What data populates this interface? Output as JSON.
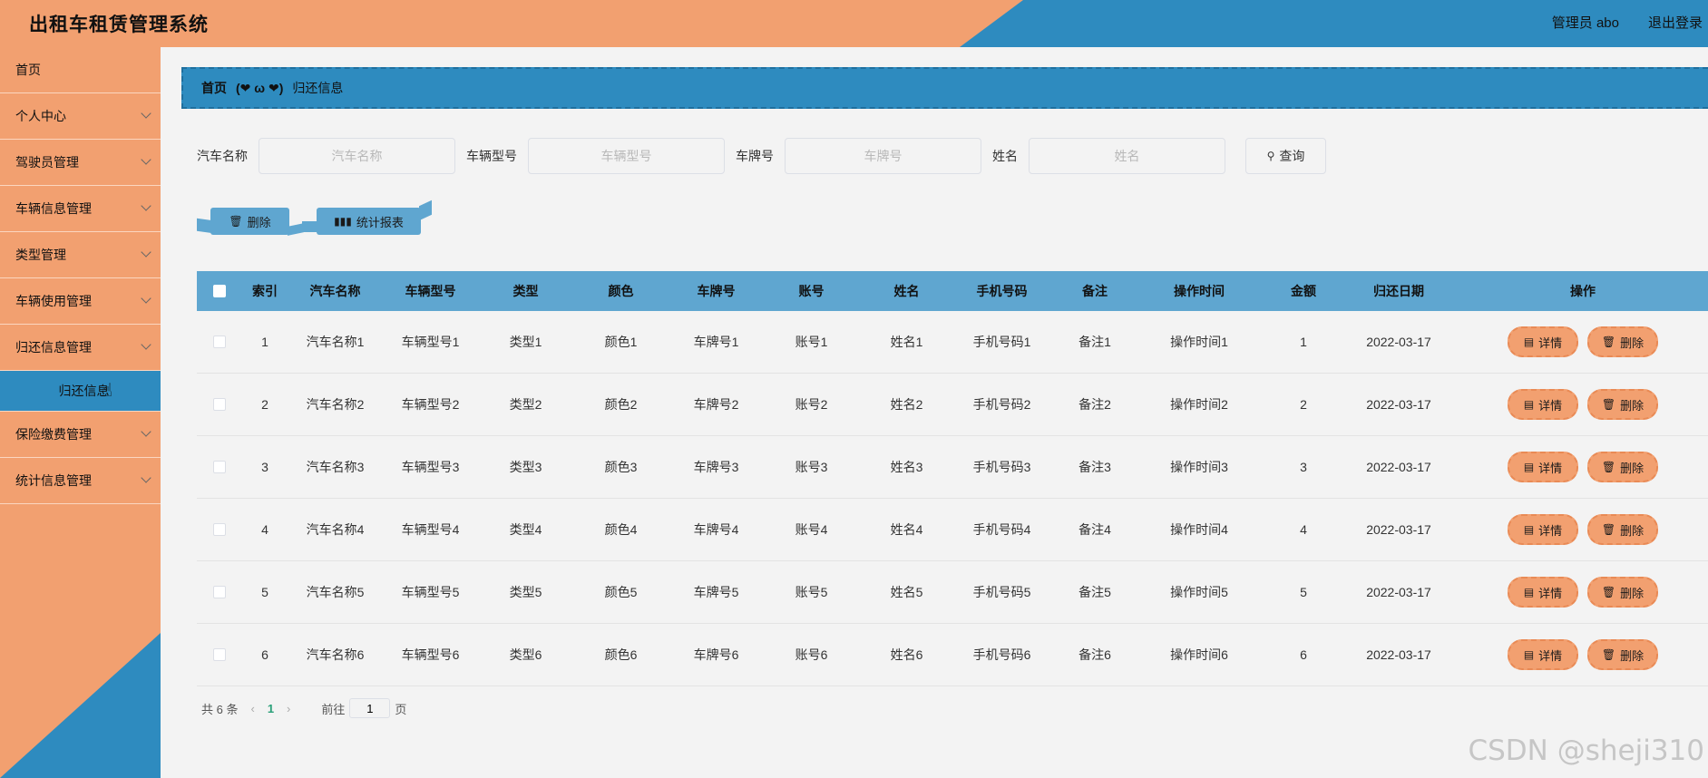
{
  "header": {
    "title": "出租车租赁管理系统",
    "user": "管理员 abo",
    "logout": "退出登录"
  },
  "sidebar": {
    "items": [
      {
        "label": "首页",
        "has_chevron": false
      },
      {
        "label": "个人中心",
        "has_chevron": true
      },
      {
        "label": "驾驶员管理",
        "has_chevron": true
      },
      {
        "label": "车辆信息管理",
        "has_chevron": true
      },
      {
        "label": "类型管理",
        "has_chevron": true
      },
      {
        "label": "车辆使用管理",
        "has_chevron": true
      },
      {
        "label": "归还信息管理",
        "has_chevron": true
      },
      {
        "label": "保险缴费管理",
        "has_chevron": true
      },
      {
        "label": "统计信息管理",
        "has_chevron": true
      }
    ],
    "active_sub": "归还信息"
  },
  "breadcrumb": {
    "home": "首页",
    "separator": "(❤ ω ❤)",
    "current": "归还信息"
  },
  "search": {
    "fields": [
      {
        "label": "汽车名称",
        "placeholder": "汽车名称"
      },
      {
        "label": "车辆型号",
        "placeholder": "车辆型号"
      },
      {
        "label": "车牌号",
        "placeholder": "车牌号"
      },
      {
        "label": "姓名",
        "placeholder": "姓名"
      }
    ],
    "button": "查询"
  },
  "actions": {
    "delete": "删除",
    "report": "统计报表"
  },
  "table": {
    "headers": [
      "索引",
      "汽车名称",
      "车辆型号",
      "类型",
      "颜色",
      "车牌号",
      "账号",
      "姓名",
      "手机号码",
      "备注",
      "操作时间",
      "金额",
      "归还日期",
      "操作"
    ],
    "rows": [
      [
        "1",
        "汽车名称1",
        "车辆型号1",
        "类型1",
        "颜色1",
        "车牌号1",
        "账号1",
        "姓名1",
        "手机号码1",
        "备注1",
        "操作时间1",
        "1",
        "2022-03-17"
      ],
      [
        "2",
        "汽车名称2",
        "车辆型号2",
        "类型2",
        "颜色2",
        "车牌号2",
        "账号2",
        "姓名2",
        "手机号码2",
        "备注2",
        "操作时间2",
        "2",
        "2022-03-17"
      ],
      [
        "3",
        "汽车名称3",
        "车辆型号3",
        "类型3",
        "颜色3",
        "车牌号3",
        "账号3",
        "姓名3",
        "手机号码3",
        "备注3",
        "操作时间3",
        "3",
        "2022-03-17"
      ],
      [
        "4",
        "汽车名称4",
        "车辆型号4",
        "类型4",
        "颜色4",
        "车牌号4",
        "账号4",
        "姓名4",
        "手机号码4",
        "备注4",
        "操作时间4",
        "4",
        "2022-03-17"
      ],
      [
        "5",
        "汽车名称5",
        "车辆型号5",
        "类型5",
        "颜色5",
        "车牌号5",
        "账号5",
        "姓名5",
        "手机号码5",
        "备注5",
        "操作时间5",
        "5",
        "2022-03-17"
      ],
      [
        "6",
        "汽车名称6",
        "车辆型号6",
        "类型6",
        "颜色6",
        "车牌号6",
        "账号6",
        "姓名6",
        "手机号码6",
        "备注6",
        "操作时间6",
        "6",
        "2022-03-17"
      ]
    ],
    "row_actions": {
      "detail": "详情",
      "delete": "删除"
    }
  },
  "pagination": {
    "total": "共 6 条",
    "current": "1",
    "goto_prefix": "前往",
    "goto_value": "1",
    "goto_suffix": "页"
  },
  "watermark": "CSDN @sheji310",
  "colors": {
    "peach": "#f2a070",
    "blue": "#2e8bbf",
    "table_header": "#5fa6d0"
  },
  "icons": {
    "search": "search-icon",
    "trash": "trash-icon",
    "chart": "bar-chart-icon",
    "detail": "document-icon"
  }
}
